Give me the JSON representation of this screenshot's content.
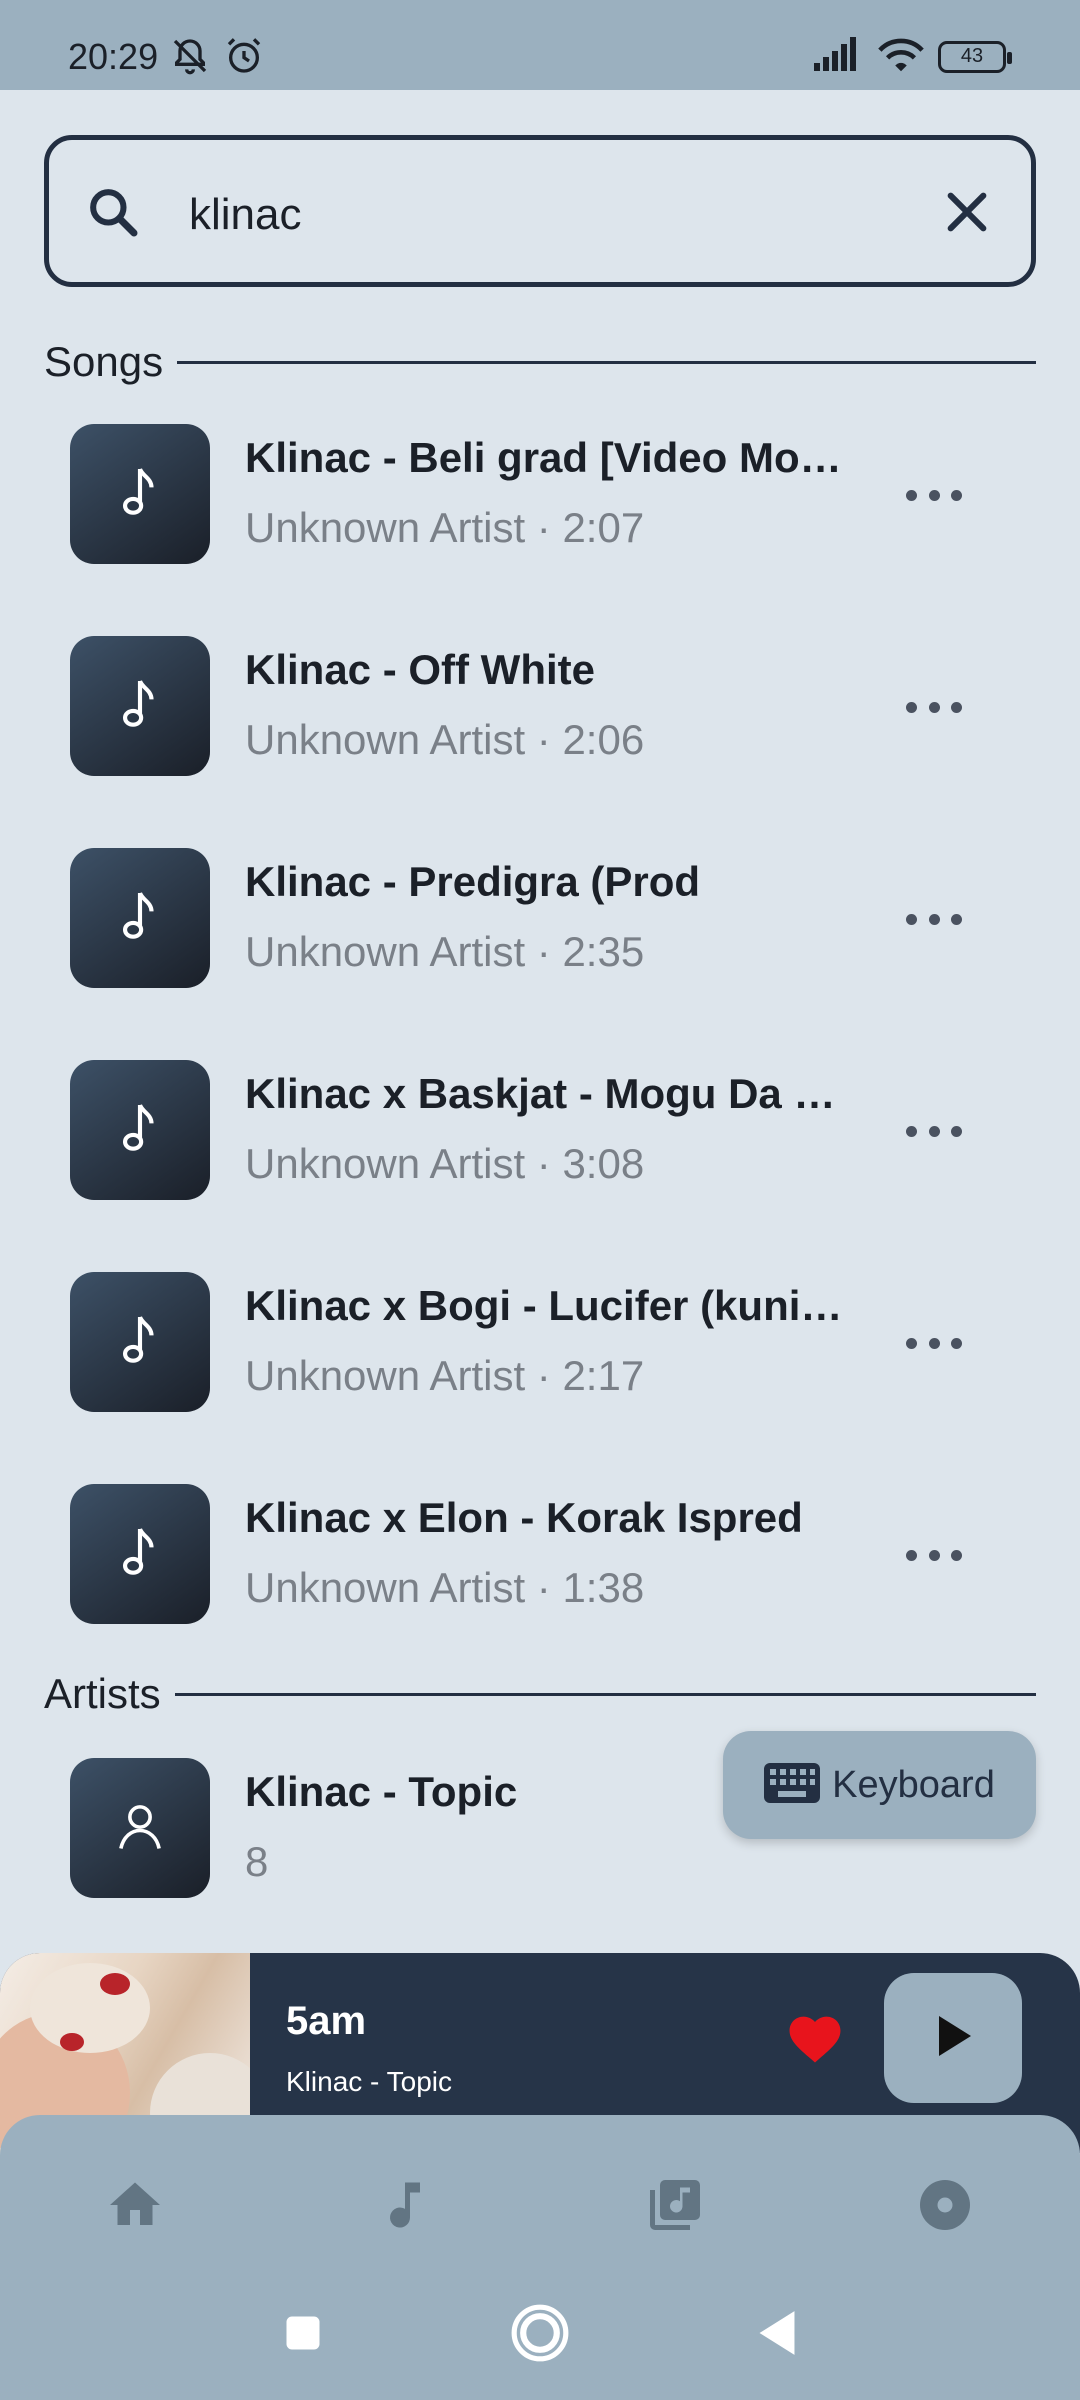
{
  "status_bar": {
    "time": "20:29",
    "battery": "43"
  },
  "search": {
    "query": "klinac"
  },
  "sections": {
    "songs_title": "Songs",
    "artists_title": "Artists"
  },
  "songs": [
    {
      "title": "Klinac - Beli grad [Video Mo…",
      "subtitle": "Unknown Artist · 2:07"
    },
    {
      "title": "Klinac - Off White",
      "subtitle": "Unknown Artist · 2:06"
    },
    {
      "title": "Klinac - Predigra (Prod",
      "subtitle": "Unknown Artist · 2:35"
    },
    {
      "title": "Klinac x Baskjat - Mogu Da …",
      "subtitle": "Unknown Artist · 3:08"
    },
    {
      "title": "Klinac x Bogi - Lucifer (kuni…",
      "subtitle": "Unknown Artist · 2:17"
    },
    {
      "title": "Klinac x Elon - Korak Ispred",
      "subtitle": "Unknown Artist · 1:38"
    }
  ],
  "artists": [
    {
      "title": "Klinac - Topic",
      "subtitle": "8"
    }
  ],
  "keyboard_button": {
    "label": "Keyboard"
  },
  "now_playing": {
    "title": "5am",
    "artist": "Klinac - Topic",
    "liked": true
  },
  "bottom_nav": [
    "home-icon",
    "music-note-icon",
    "library-icon",
    "disc-icon"
  ],
  "colors": {
    "background": "#dde5ec",
    "accent": "#9bb0bf",
    "player_bg": "#263448",
    "heart": "#e8141c"
  }
}
